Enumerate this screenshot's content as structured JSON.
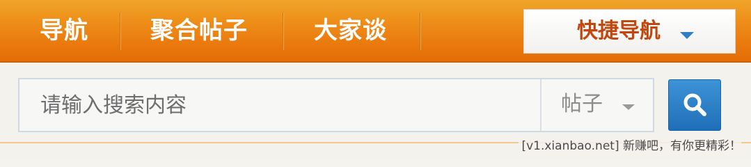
{
  "nav": {
    "items": [
      {
        "label": "导航"
      },
      {
        "label": "聚合帖子"
      },
      {
        "label": "大家谈"
      }
    ],
    "quick_nav": {
      "label": "快捷导航",
      "caret_icon": "caret-down-icon"
    }
  },
  "search": {
    "placeholder": "请输入搜索内容",
    "value": "",
    "type_select": {
      "selected": "帖子",
      "caret_icon": "caret-down-icon"
    },
    "button_icon": "magnifier-icon"
  },
  "watermark": "[v1.xianbao.net] 新赚吧，有你更精彩！",
  "colors": {
    "nav_bg": "#ee8e18",
    "nav_text": "#ffffff",
    "quick_nav_text": "#c0470e",
    "accent_blue": "#2e7fc8",
    "search_button": "#2a7fc6"
  }
}
